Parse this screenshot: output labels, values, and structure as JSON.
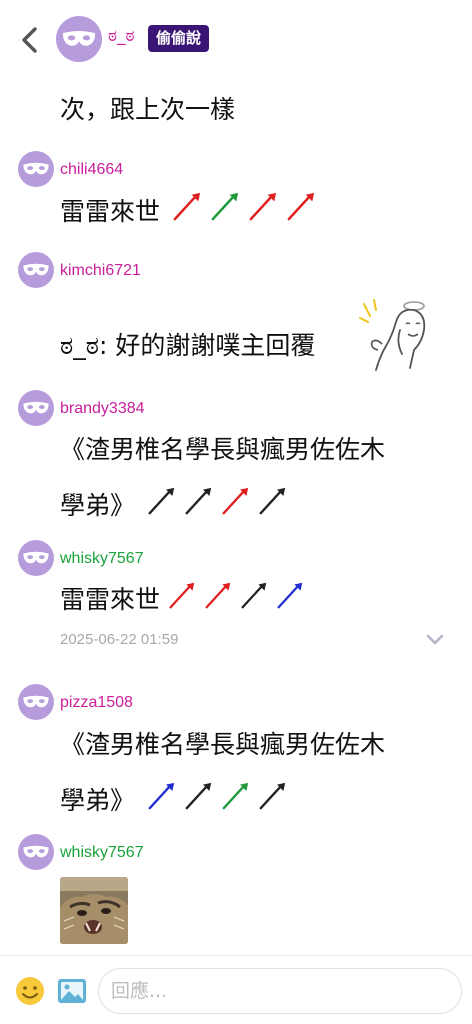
{
  "header": {
    "user": "ಠ_ಠ",
    "badge": "偷偷說"
  },
  "messages": [
    {
      "text": "次，跟上次一樣"
    },
    {
      "user": "chili4664",
      "text": "雷雷來世",
      "horns": [
        "red",
        "green",
        "red",
        "red"
      ]
    },
    {
      "user": "kimchi6721",
      "text": "ಠ_ಠ: 好的謝謝噗主回覆"
    },
    {
      "user": "brandy3384",
      "text_line1": "《渣男椎名學長與瘋男佐佐木",
      "text_line2": "學弟》",
      "horns": [
        "black",
        "black",
        "red",
        "black"
      ]
    },
    {
      "user": "whisky7567",
      "text": "雷雷來世",
      "horns": [
        "red",
        "red",
        "black",
        "blue"
      ],
      "time": "2025-06-22 01:59"
    },
    {
      "user": "pizza1508",
      "text_line1": "《渣男椎名學長與瘋男佐佐木",
      "text_line2": "學弟》",
      "horns": [
        "blue",
        "black",
        "green",
        "black"
      ]
    },
    {
      "user": "whisky7567"
    }
  ],
  "footer": {
    "placeholder": "回應..."
  },
  "colors": {
    "avatar": "#b79cdb",
    "pink_name": "#c81f9a",
    "green_name": "#1aa23b",
    "badge_bg": "#3b1575"
  },
  "icons": [
    "back-arrow-icon",
    "mask-avatar-icon",
    "chevron-down-icon",
    "emoji-icon",
    "image-icon"
  ]
}
